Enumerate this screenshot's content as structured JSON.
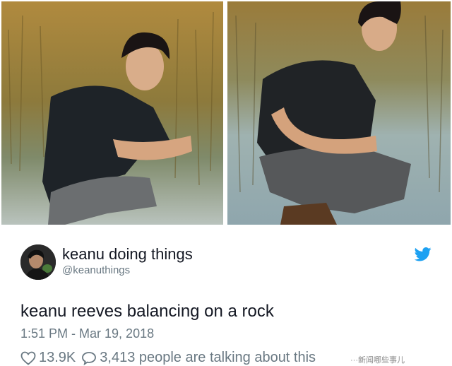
{
  "tweet": {
    "author_name": "keanu doing things",
    "author_handle": "@keanuthings",
    "text": "keanu reeves balancing on a rock",
    "timestamp": "1:51 PM - Mar 19, 2018",
    "like_count": "13.9K",
    "reply_text": "3,413 people are talking about this"
  },
  "watermark": "···新闻哪些事儿",
  "icons": {
    "brand": "twitter-bird-icon",
    "like": "heart-icon",
    "reply": "speech-bubble-icon"
  },
  "colors": {
    "twitter_blue": "#1da1f2",
    "text_primary": "#141823",
    "text_secondary": "#697882"
  }
}
